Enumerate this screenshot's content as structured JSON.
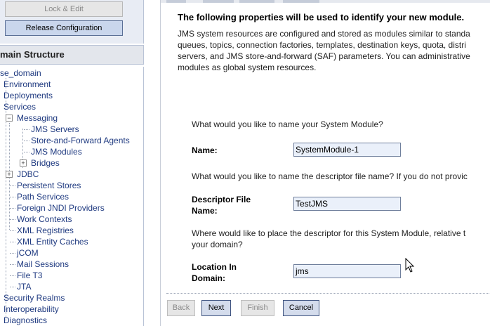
{
  "change_center": {
    "lock_edit_label": "Lock & Edit",
    "release_label": "Release Configuration"
  },
  "domain_structure": {
    "title": "main Structure",
    "items": [
      "se_domain",
      "Environment",
      "Deployments",
      "Services",
      "Messaging",
      "JMS Servers",
      "Store-and-Forward Agents",
      "JMS Modules",
      "Bridges",
      "JDBC",
      "Persistent Stores",
      "Path Services",
      "Foreign JNDI Providers",
      "Work Contexts",
      "XML Registries",
      "XML Entity Caches",
      "jCOM",
      "Mail Sessions",
      "File T3",
      "JTA",
      "Security Realms",
      "Interoperability",
      "Diagnostics"
    ],
    "expanders": [
      "−",
      "+",
      "+"
    ]
  },
  "form": {
    "title": "The following properties will be used to identify your new module.",
    "intro": "JMS system resources are configured and stored as modules similar to standa\nqueues, topics, connection factories, templates, destination keys, quota, distri\nservers, and JMS store-and-forward (SAF) parameters. You can administrative\nmodules as global system resources.",
    "q_name": "What would you like to name your System Module?",
    "name_label": "Name:",
    "name_value": "SystemModule-1",
    "q_descriptor": "What would you like to name the descriptor file name? If you do not provic",
    "descriptor_label_1": "Descriptor File",
    "descriptor_label_2": "Name:",
    "descriptor_value": "TestJMS",
    "q_location_1": "Where would like to place the descriptor for this System Module, relative t",
    "q_location_2": "your domain?",
    "location_label_1": "Location In",
    "location_label_2": "Domain:",
    "location_value": "jms"
  },
  "buttons": {
    "back": "Back",
    "next": "Next",
    "finish": "Finish",
    "cancel": "Cancel"
  },
  "colors": {
    "link": "#1f3a80",
    "field_bg": "#eaf0fa"
  }
}
